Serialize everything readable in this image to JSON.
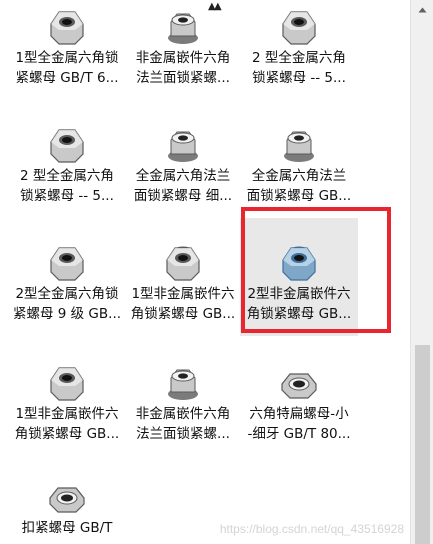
{
  "items": [
    {
      "label": "1型全金属六角锁\n紧螺母 GB/T 6...",
      "icon": "hex-nut-silver-icon"
    },
    {
      "label": "非金属嵌件六角\n法兰面锁紧螺...",
      "icon": "flange-nut-silver-icon"
    },
    {
      "label": "2 型全金属六角\n锁紧螺母 -- 5...",
      "icon": "hex-nut-silver-icon"
    },
    {
      "label": "2 型全金属六角\n锁紧螺母 -- 5...",
      "icon": "hex-nut-silver-icon"
    },
    {
      "label": "全金属六角法兰\n面锁紧螺母 细...",
      "icon": "flange-nut-silver-icon"
    },
    {
      "label": "全金属六角法兰\n面锁紧螺母 GB...",
      "icon": "flange-nut-silver-icon"
    },
    {
      "label": "2型全金属六角锁\n紧螺母 9 级 GB...",
      "icon": "hex-nut-silver-icon"
    },
    {
      "label": "1型非金属嵌件六\n角锁紧螺母 GB...",
      "icon": "nylon-insert-nut-silver-icon"
    },
    {
      "label": "2型非金属嵌件六\n角锁紧螺母 GB...",
      "icon": "nylon-insert-nut-blue-icon"
    },
    {
      "label": "1型非金属嵌件六\n角锁紧螺母 GB...",
      "icon": "hex-nut-silver-icon"
    },
    {
      "label": "非金属嵌件六角\n法兰面锁紧螺...",
      "icon": "flange-nut-silver-icon"
    },
    {
      "label": "六角特扁螺母-小\n-细牙 GB/T 80...",
      "icon": "thin-hex-nut-silver-icon"
    },
    {
      "label": "扣紧螺母 GB/T",
      "icon": "thin-hex-nut-silver-icon"
    }
  ],
  "selected_index": 8,
  "colors": {
    "highlight": "#e8262f",
    "nut_blue": "#7fa7c8",
    "nut_silver": "#c9c9c9"
  },
  "watermark": "https://blog.csdn.net/qq_43516928"
}
